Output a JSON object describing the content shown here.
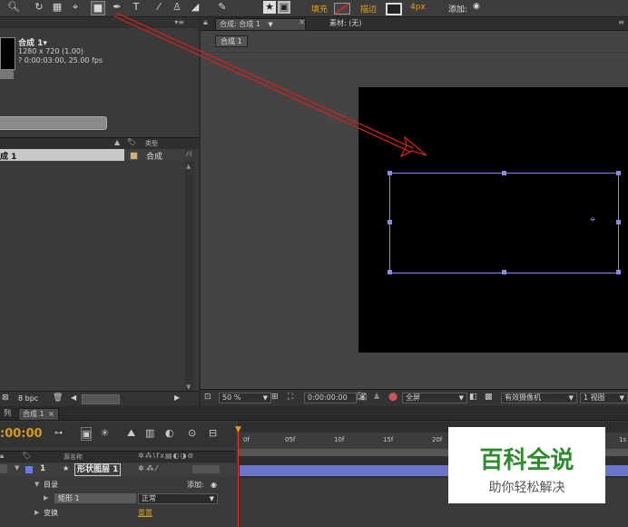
{
  "toolbar": {
    "fill_label": "填充",
    "stroke_label": "描边",
    "stroke_width": "4px",
    "add_label": "添加:"
  },
  "project": {
    "comp_name": "合成 1▾",
    "comp_size": "1280 x 720 (1.00)",
    "comp_time": "? 0:00:03:00, 25.00 fps",
    "col_type": "类型",
    "item_name": "成 1",
    "item_type": "合成",
    "bpc": "8 bpc"
  },
  "comp_panel": {
    "tab_comp": "合成: 合成 1",
    "tab_footage": "素材: (无)",
    "breadcrumb": "合成 1",
    "zoom": "50 %",
    "timecode": "0:00:00:00",
    "resolution": "全屏",
    "camera": "有效摄像机",
    "views": "1 视图"
  },
  "timeline": {
    "tab_render": "列",
    "tab_comp": "合成 1",
    "timecode": ":00:00",
    "col_source": "源名称",
    "layer_index": "1",
    "layer_name": "形状图层 1",
    "contents_label": "目录",
    "add_label": "添加:",
    "rect_label": "矩形 1",
    "blend_mode": "正常",
    "transform_label": "变换",
    "reset_label": "重置",
    "ruler": [
      "0f",
      "05f",
      "10f",
      "15f",
      "20f",
      "1s"
    ]
  },
  "watermark": {
    "title": "百科全说",
    "subtitle": "助你轻松解决"
  },
  "colors": {
    "accent_orange": "#e3a01a",
    "selection_blue": "#8888ee",
    "arrow_red": "#cc2222"
  }
}
